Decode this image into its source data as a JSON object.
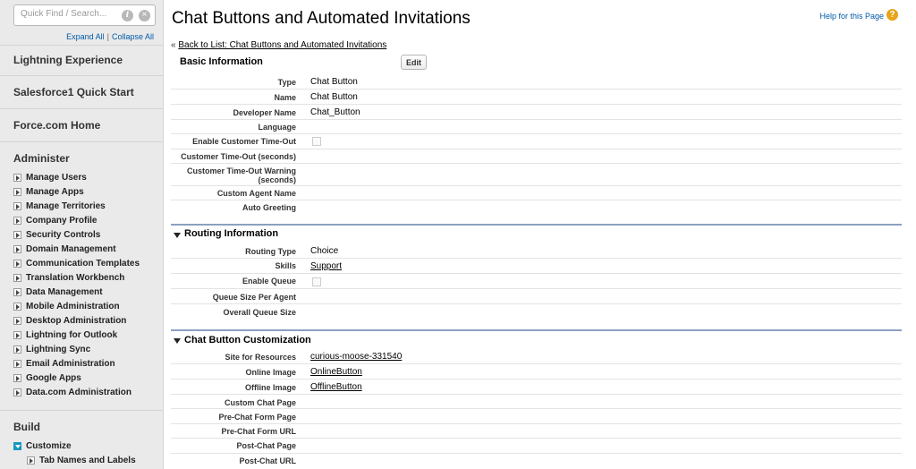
{
  "sidebar": {
    "search_placeholder": "Quick Find / Search...",
    "info_icon": "i",
    "clear_icon": "×",
    "expand_all": "Expand All",
    "separator": "|",
    "collapse_all": "Collapse All",
    "top_links": [
      "Lightning Experience",
      "Salesforce1 Quick Start",
      "Force.com Home"
    ],
    "administer": {
      "title": "Administer",
      "items": [
        "Manage Users",
        "Manage Apps",
        "Manage Territories",
        "Company Profile",
        "Security Controls",
        "Domain Management",
        "Communication Templates",
        "Translation Workbench",
        "Data Management",
        "Mobile Administration",
        "Desktop Administration",
        "Lightning for Outlook",
        "Lightning Sync",
        "Email Administration",
        "Google Apps",
        "Data.com Administration"
      ]
    },
    "build": {
      "title": "Build",
      "items": [
        "Customize",
        "Tab Names and Labels"
      ]
    }
  },
  "main": {
    "title": "Chat Buttons and Automated Invitations",
    "help_link": "Help for this Page",
    "help_icon": "?",
    "back_prefix": "«",
    "back_link": "Back to List: Chat Buttons and Automated Invitations",
    "basic": {
      "title": "Basic Information",
      "edit_label": "Edit",
      "rows": [
        {
          "label": "Type",
          "value": "Chat Button"
        },
        {
          "label": "Name",
          "value": "Chat Button"
        },
        {
          "label": "Developer Name",
          "value": "Chat_Button"
        },
        {
          "label": "Language",
          "value": ""
        },
        {
          "label": "Enable Customer Time-Out",
          "value": ""
        },
        {
          "label": "Customer Time-Out (seconds)",
          "value": ""
        },
        {
          "label": "Customer Time-Out Warning (seconds)",
          "value": ""
        },
        {
          "label": "Custom Agent Name",
          "value": ""
        },
        {
          "label": "Auto Greeting",
          "value": ""
        }
      ]
    },
    "routing": {
      "title": "Routing Information",
      "rows": [
        {
          "label": "Routing Type",
          "value": "Choice"
        },
        {
          "label": "Skills",
          "value": "Support"
        },
        {
          "label": "Enable Queue",
          "value": ""
        },
        {
          "label": "Queue Size Per Agent",
          "value": ""
        },
        {
          "label": "Overall Queue Size",
          "value": ""
        }
      ]
    },
    "customization": {
      "title": "Chat Button Customization",
      "rows": [
        {
          "label": "Site for Resources",
          "value": "curious-moose-331540"
        },
        {
          "label": "Online Image",
          "value": "OnlineButton"
        },
        {
          "label": "Offline Image",
          "value": "OfflineButton"
        },
        {
          "label": "Custom Chat Page",
          "value": ""
        },
        {
          "label": "Pre-Chat Form Page",
          "value": ""
        },
        {
          "label": "Pre-Chat Form URL",
          "value": ""
        },
        {
          "label": "Post-Chat Page",
          "value": ""
        },
        {
          "label": "Post-Chat URL",
          "value": ""
        }
      ]
    }
  }
}
